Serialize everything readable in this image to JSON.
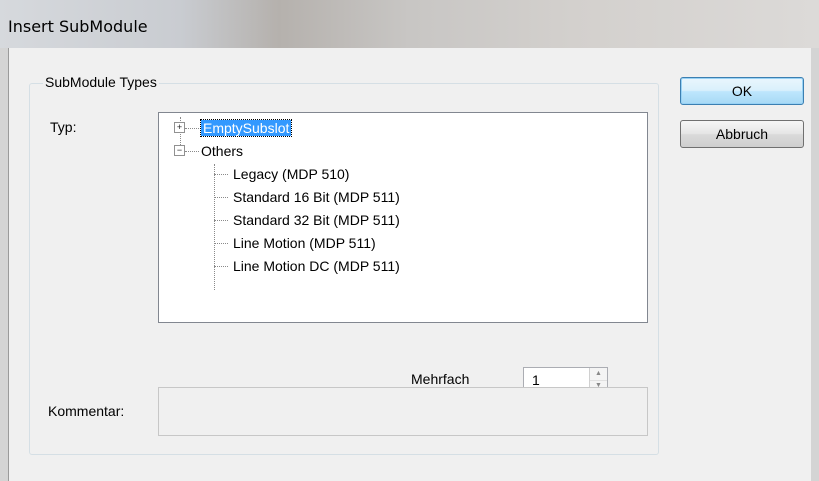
{
  "window": {
    "title": "Insert SubModule"
  },
  "group": {
    "label": "SubModule Types"
  },
  "typ": {
    "label": "Typ:",
    "tree": {
      "root1": {
        "label": "EmptySubslot",
        "expanded": false,
        "selected": true
      },
      "root2": {
        "label": "Others",
        "expanded": true
      },
      "children": [
        "Legacy (MDP 510)",
        "Standard 16 Bit (MDP 511)",
        "Standard 32 Bit (MDP 511)",
        "Line Motion (MDP 511)",
        "Line Motion DC (MDP 511)"
      ]
    }
  },
  "mehrfach": {
    "label": "Mehrfach",
    "value": "1"
  },
  "kommentar": {
    "label": "Kommentar:",
    "value": ""
  },
  "buttons": {
    "ok": "OK",
    "cancel": "Abbruch"
  },
  "icons": {
    "expand": "plus-icon",
    "collapse": "minus-icon",
    "spin_up": "arrow-up-icon",
    "spin_down": "arrow-down-icon"
  },
  "colors": {
    "selection": "#3399ff"
  }
}
